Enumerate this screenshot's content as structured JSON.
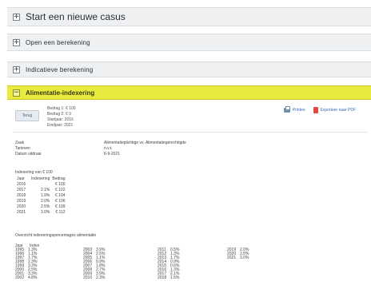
{
  "accordion": {
    "start": {
      "icon": "+",
      "title": "Start een nieuwe casus"
    },
    "berekening": {
      "icon": "+",
      "title": "Open een berekening"
    },
    "indicatief": {
      "icon": "+",
      "title": "Indicatieve berekening"
    },
    "indexering": {
      "icon": "−",
      "title": "Alimentatie-indexering"
    }
  },
  "panel": {
    "back_label": "Terug",
    "bedrag_lines": [
      "Bedrag 1: € 100",
      "Bedrag 2: € 0",
      "Startjaar: 2016",
      "Eindjaar: 2021"
    ],
    "print_label": "Printen",
    "pdf_label": "Exporteer naar PDF",
    "info": [
      {
        "key": "Zaak",
        "value": "Alimentatieplichtige vs. Alimentatiegerechtigde"
      },
      {
        "key": "Tarieven",
        "value": "n.v.t."
      },
      {
        "key": "Datum uitdraai",
        "value": "6-9-2021"
      }
    ],
    "indexering": {
      "title": "Indexering van € 100",
      "columns": [
        "Jaar",
        "Indexering",
        "Bedrag"
      ],
      "rows": [
        [
          "2016",
          "",
          "€ 100"
        ],
        [
          "2017",
          "2.1%",
          "€ 102"
        ],
        [
          "2018",
          "1.9%",
          "€ 104"
        ],
        [
          "2019",
          "2.0%",
          "€ 106"
        ],
        [
          "2020",
          "2.5%",
          "€ 109"
        ],
        [
          "2021",
          "3.0%",
          "€ 112"
        ]
      ]
    },
    "overzicht": {
      "title": "Overzicht indexeringspercentages alimentatie",
      "headers": [
        "Jaar",
        "Index"
      ],
      "columns": [
        [
          [
            "1995",
            "1.3%"
          ],
          [
            "1996",
            "1.1%"
          ],
          [
            "1997",
            "1.7%"
          ],
          [
            "1998",
            "2.3%"
          ],
          [
            "1999",
            "3.3%"
          ],
          [
            "2000",
            "2.5%"
          ],
          [
            "2001",
            "3.3%"
          ],
          [
            "2002",
            "4.8%"
          ]
        ],
        [
          [
            "2003",
            "3.9%"
          ],
          [
            "2004",
            "2.5%"
          ],
          [
            "2005",
            "1.1%"
          ],
          [
            "2006",
            "0.9%"
          ],
          [
            "2007",
            "1.8%"
          ],
          [
            "2008",
            "2.7%"
          ],
          [
            "2009",
            "3.9%"
          ],
          [
            "2010",
            "2.3%"
          ]
        ],
        [
          [
            "2011",
            "0.5%"
          ],
          [
            "2012",
            "1.3%"
          ],
          [
            "2013",
            "1.7%"
          ],
          [
            "2014",
            "0.9%"
          ],
          [
            "2015",
            "0.6%"
          ],
          [
            "2016",
            "1.3%"
          ],
          [
            "2017",
            "2.1%"
          ],
          [
            "2018",
            "1.5%"
          ]
        ],
        [
          [
            "2019",
            "2.0%"
          ],
          [
            "2020",
            "2.5%"
          ],
          [
            "2021",
            "3.0%"
          ]
        ]
      ]
    }
  }
}
